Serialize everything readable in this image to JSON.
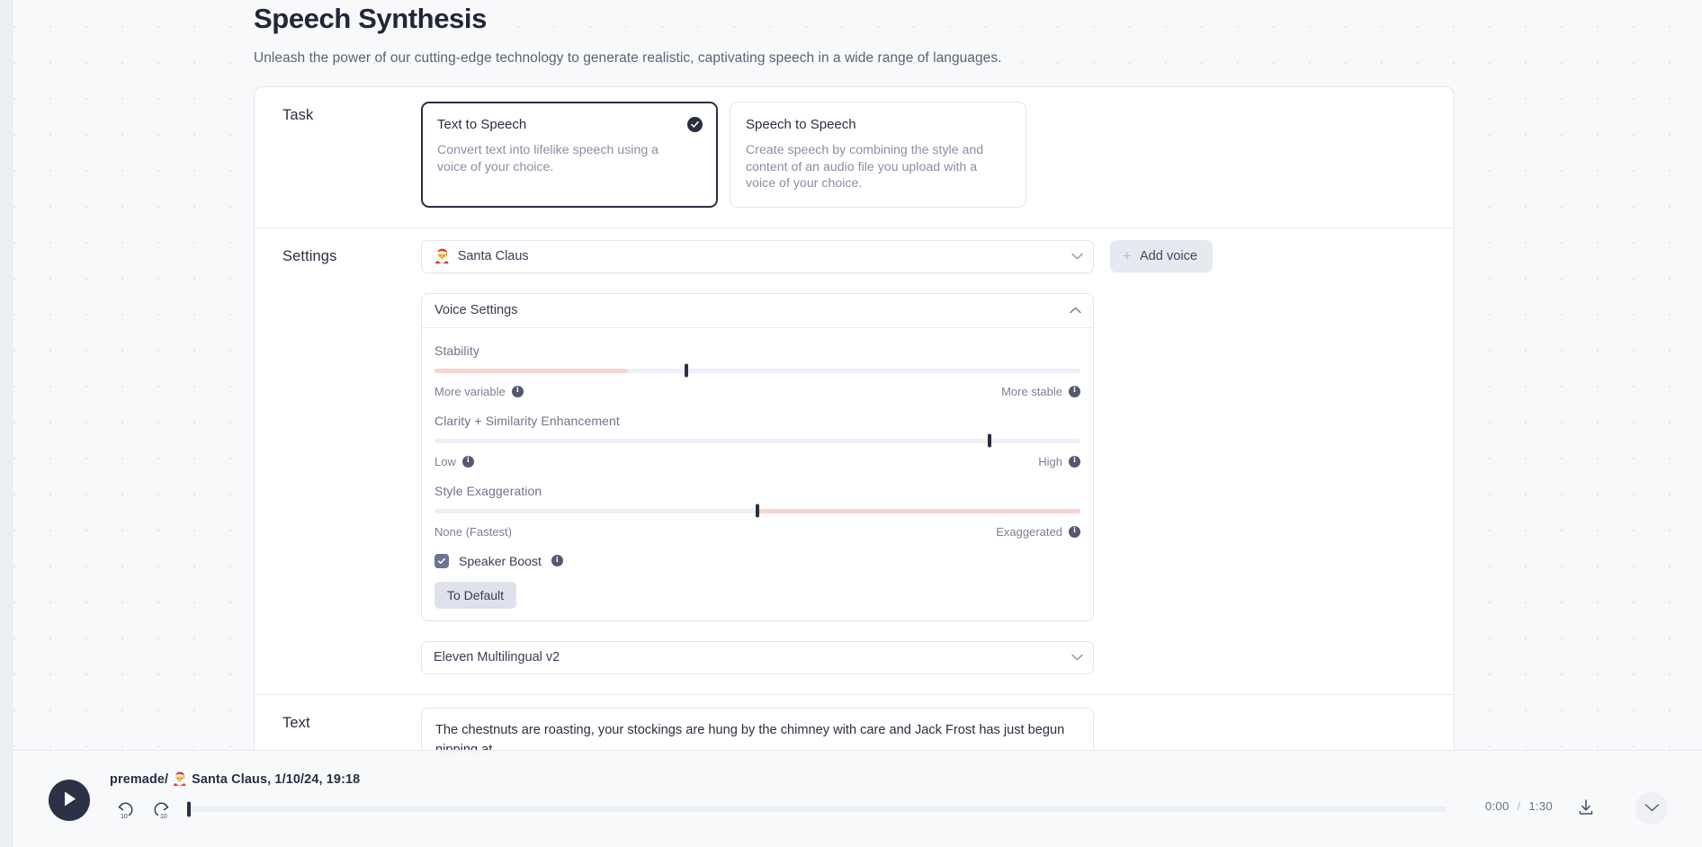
{
  "header": {
    "title": "Speech Synthesis",
    "subtitle": "Unleash the power of our cutting-edge technology to generate realistic, captivating speech in a wide range of languages."
  },
  "task": {
    "label": "Task",
    "cards": [
      {
        "title": "Text to Speech",
        "desc": "Convert text into lifelike speech using a voice of your choice.",
        "selected": true
      },
      {
        "title": "Speech to Speech",
        "desc": "Create speech by combining the style and content of an audio file you upload with a voice of your choice.",
        "selected": false
      }
    ]
  },
  "settings": {
    "label": "Settings",
    "voice_emoji": "🎅",
    "voice_value": "Santa Claus",
    "add_voice_label": "Add voice",
    "voice_settings_title": "Voice Settings",
    "sliders": [
      {
        "name": "Stability",
        "left_label": "More variable",
        "right_label": "More stable",
        "value_pct": 39,
        "fill_side": "left",
        "fill_pct": 30
      },
      {
        "name": "Clarity + Similarity Enhancement",
        "left_label": "Low",
        "right_label": "High",
        "value_pct": 86,
        "fill_side": "none",
        "fill_pct": 0
      },
      {
        "name": "Style Exaggeration",
        "left_label": "None (Fastest)",
        "right_label": "Exaggerated",
        "value_pct": 50,
        "fill_side": "right",
        "fill_pct": 50
      }
    ],
    "speaker_boost_label": "Speaker Boost",
    "speaker_boost_checked": true,
    "to_default_label": "To Default",
    "model_value": "Eleven Multilingual v2"
  },
  "text": {
    "label": "Text",
    "value": "The chestnuts are roasting, your stockings are hung by the chimney with care and Jack Frost has just begun nipping at"
  },
  "player": {
    "title_prefix": "premade/",
    "title_emoji": "🎅",
    "title_rest": "Santa Claus, 1/10/24, 19:18",
    "current_time": "0:00",
    "total_time": "1:30",
    "separator": "/",
    "progress_pct": 0
  },
  "colors": {
    "accent_dark": "#2b2d42",
    "slider_fill": "#f9d3d1",
    "track": "#eef0f8",
    "page_bg": "#f8f9fb"
  }
}
